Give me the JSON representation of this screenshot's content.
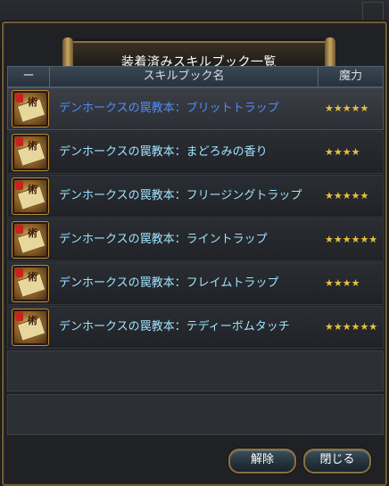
{
  "dialog": {
    "title": "装着済みスキルブック一覧",
    "columns": {
      "dash": "ー",
      "name": "スキルブック名",
      "power": "魔力"
    },
    "items": [
      {
        "name": "デンホークスの罠教本：ブリットトラップ",
        "stars": "★★★★★",
        "selected": true
      },
      {
        "name": "デンホークスの罠教本：まどろみの香り",
        "stars": "★★★★",
        "selected": false
      },
      {
        "name": "デンホークスの罠教本：フリージングトラップ",
        "stars": "★★★★★",
        "selected": false
      },
      {
        "name": "デンホークスの罠教本：ライントラップ",
        "stars": "★★★★★★",
        "selected": false
      },
      {
        "name": "デンホークスの罠教本：フレイムトラップ",
        "stars": "★★★★",
        "selected": false
      },
      {
        "name": "デンホークスの罠教本：テディーボムタッチ",
        "stars": "★★★★★★",
        "selected": false
      }
    ],
    "buttons": {
      "release": "解除",
      "close": "閉じる"
    }
  },
  "colors": {
    "accent_gold": "#8a7142",
    "name_text": "#9fe3ff",
    "selected_text": "#4f8ef5",
    "star": "#e9c13c"
  }
}
